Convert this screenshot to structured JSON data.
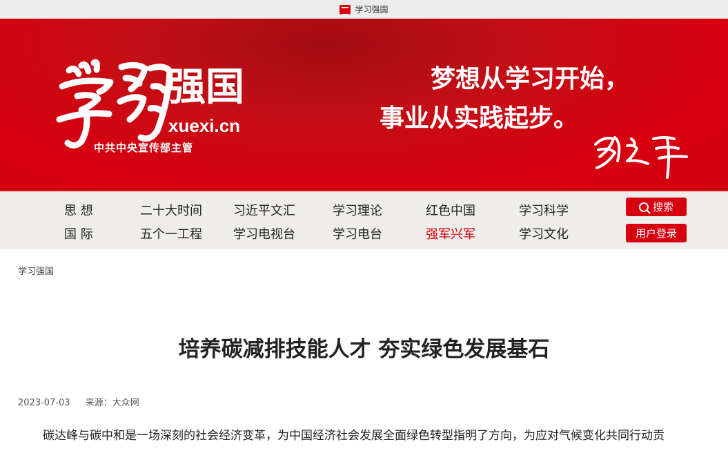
{
  "tab": {
    "title": "学习强国"
  },
  "banner": {
    "brand_name": "强国",
    "brand_domain": "xuexi.cn",
    "brand_org": "中共中央宣传部主管",
    "motto_line1": "梦想从学习开始，",
    "motto_line2": "事业从实践起步。"
  },
  "nav": {
    "row1": [
      "思 想",
      "二十大时间",
      "习近平文汇",
      "学习理论",
      "红色中国",
      "学习科学"
    ],
    "row2": [
      "国 际",
      "五个一工程",
      "学习电视台",
      "学习电台",
      "强军兴军",
      "学习文化"
    ],
    "active_item": "强军兴军",
    "search_label": "搜索",
    "login_label": "用户登录"
  },
  "content": {
    "breadcrumb": "学习强国",
    "title": "培养碳减排技能人才 夯实绿色发展基石",
    "date": "2023-07-03",
    "source": "来源：大众网",
    "paragraph": "碳达峰与碳中和是一场深刻的社会经济变革，为中国经济社会发展全面绿色转型指明了方向，为应对气候变化共同行动贡"
  },
  "colors": {
    "brand_red": "#d7000f",
    "nav_bg": "#efedea",
    "tab_bg": "#ececec"
  }
}
